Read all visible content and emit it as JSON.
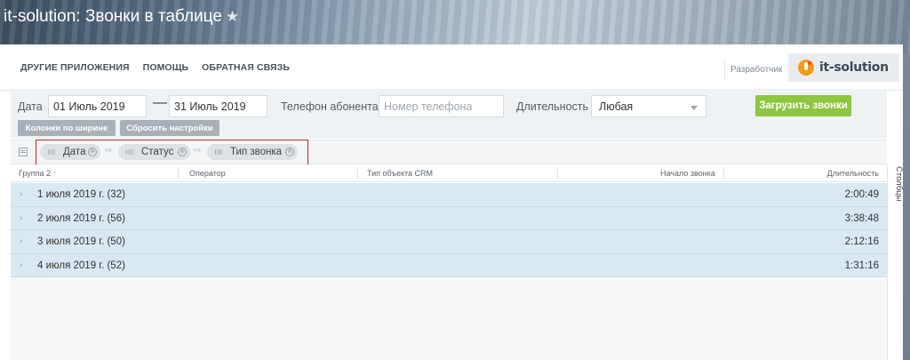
{
  "page": {
    "title": "it-solution: Звонки в таблице",
    "star": "★"
  },
  "nav": {
    "links": [
      "ДРУГИЕ ПРИЛОЖЕНИЯ",
      "ПОМОЩЬ",
      "ОБРАТНАЯ СВЯЗЬ"
    ],
    "developer_label": "Разработчик",
    "brand": "it-solution"
  },
  "filters": {
    "date_label": "Дата",
    "date_from": "01 Июль 2019",
    "date_separator": "—",
    "date_to": "31 Июль 2019",
    "phone_label": "Телефон абонента",
    "phone_placeholder": "Номер телефона",
    "duration_label": "Длительность",
    "duration_value": "Любая",
    "load_button": "Загрузить звонки",
    "fit_columns_button": "Колонки по ширине",
    "reset_button": "Сбросить настройки"
  },
  "grouping": {
    "chips": [
      "Дата",
      "Статус",
      "Тип звонка"
    ],
    "remove_glyph": "⊗",
    "arrow_glyph": "⇨"
  },
  "table": {
    "columns": [
      "Группа 2",
      "Оператор",
      "Тип объекта CRM",
      "Начало звонка",
      "Длительность"
    ],
    "sort_glyph": "↑",
    "rows": [
      {
        "label": "1 июля 2019 г. (32)",
        "duration": "2:00:49"
      },
      {
        "label": "2 июля 2019 г. (56)",
        "duration": "3:38:48"
      },
      {
        "label": "3 июля 2019 г. (50)",
        "duration": "2:12:16"
      },
      {
        "label": "4 июля 2019 г. (52)",
        "duration": "1:31:16"
      }
    ],
    "row_chevron": "›",
    "columns_panel_label": "Столбцы"
  },
  "icons": {
    "star": "star-icon",
    "brand": "it-solution-logo-icon",
    "caret": "chevron-down-icon",
    "group_toggle": "grouping-panel-icon",
    "chip_grip": "drag-handle-icon",
    "chip_remove": "close-circle-icon",
    "row_expand": "chevron-right-icon"
  },
  "colors": {
    "accent_green": "#8dc63f",
    "row_highlight": "#d9e8f1",
    "group_outline": "#b3262a",
    "brand_orange": "#f39c12"
  }
}
